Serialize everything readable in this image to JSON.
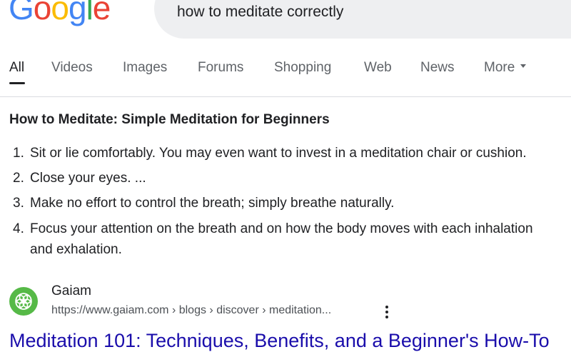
{
  "header": {
    "logo_text": "Google",
    "logo_colors": [
      "#4285F4",
      "#EA4335",
      "#FBBC05",
      "#4285F4",
      "#34A853",
      "#EA4335"
    ],
    "search_query": "how to meditate correctly"
  },
  "tabs": [
    {
      "label": "All",
      "active": true
    },
    {
      "label": "Videos",
      "active": false
    },
    {
      "label": "Images",
      "active": false
    },
    {
      "label": "Forums",
      "active": false
    },
    {
      "label": "Shopping",
      "active": false
    },
    {
      "label": "Web",
      "active": false
    },
    {
      "label": "News",
      "active": false
    },
    {
      "label": "More",
      "active": false,
      "icon": "caret-down-icon"
    }
  ],
  "snippet": {
    "title": "How to Meditate: Simple Meditation for Beginners",
    "steps": [
      {
        "number": "1.",
        "text": "Sit or lie comfortably. You may even want to invest in a meditation chair or cushion."
      },
      {
        "number": "2.",
        "text": "Close your eyes. ..."
      },
      {
        "number": "3.",
        "text": "Make no effort to control the breath; simply breathe naturally."
      },
      {
        "number": "4.",
        "text": "Focus your attention on the breath and on how the body moves with each inhalation",
        "continuation": "and exhalation."
      }
    ]
  },
  "result": {
    "site_name": "Gaiam",
    "url": "https://www.gaiam.com › blogs › discover › meditation...",
    "title": "Meditation 101: Techniques, Benefits, and a Beginner's How-To",
    "favicon": "gaiam-logo-icon",
    "favicon_color": "#56b947",
    "more_options_icon": "kebab-menu-icon"
  },
  "colors": {
    "link": "#1a0dab",
    "text": "#202124",
    "secondary_text": "#5f6368",
    "search_box": "#eeeff1"
  }
}
